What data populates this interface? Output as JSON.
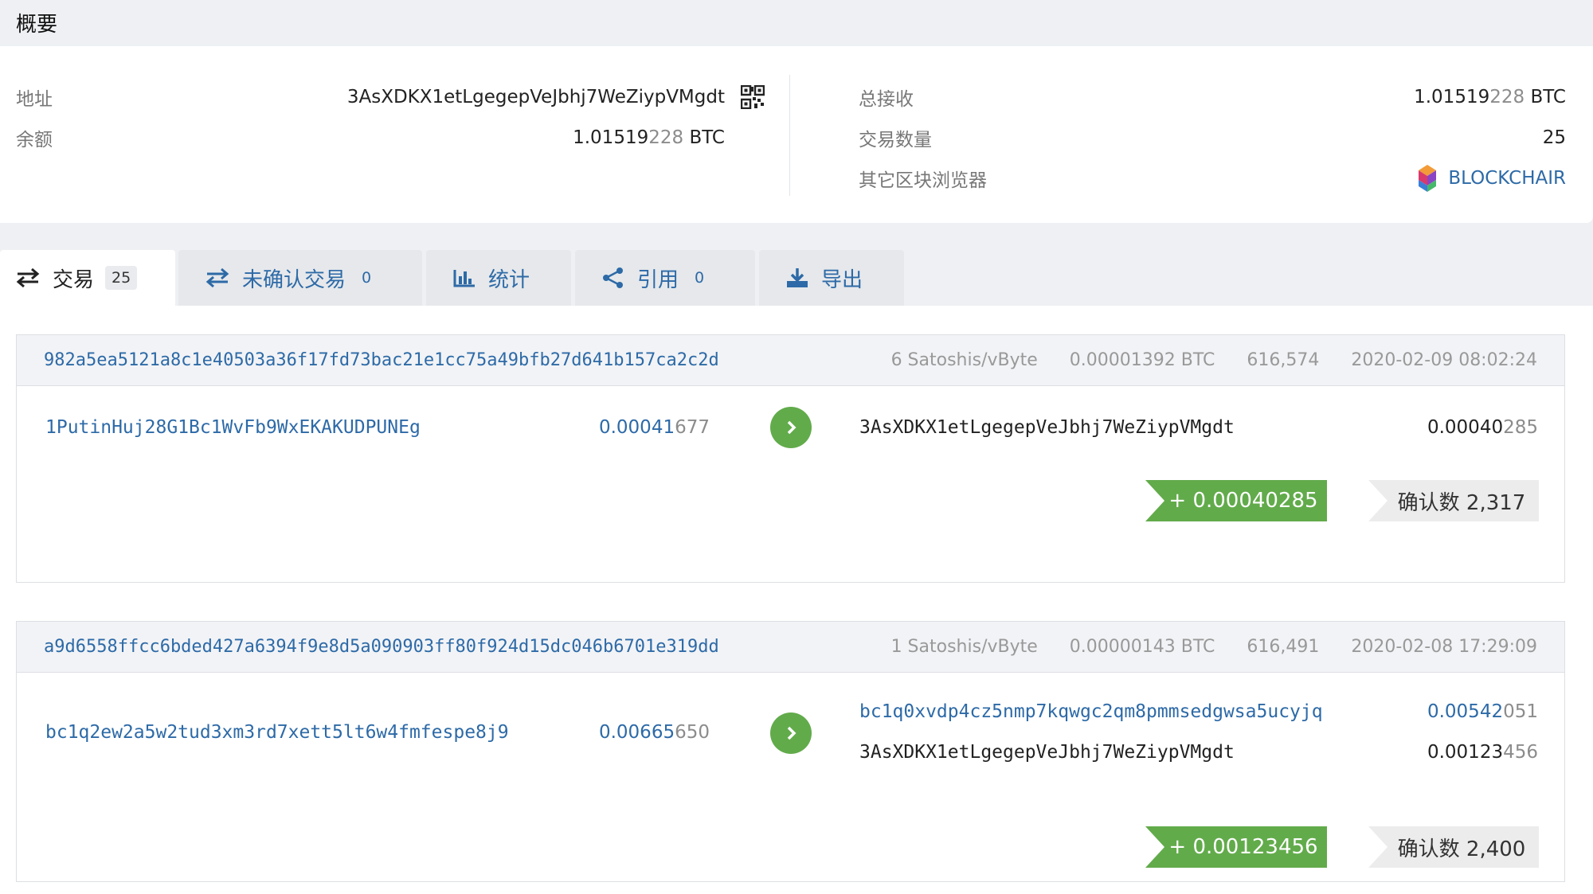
{
  "summary": {
    "title": "概要",
    "address_label": "地址",
    "address_value": "3AsXDKX1etLgegepVeJbhj7WeZiypVMgdt",
    "balance_label": "余额",
    "balance_strong": "1.01519",
    "balance_dim": "228",
    "balance_unit": " BTC",
    "total_received_label": "总接收",
    "total_received_strong": "1.01519",
    "total_received_dim": "228",
    "total_received_unit": " BTC",
    "tx_count_label": "交易数量",
    "tx_count_value": "25",
    "explorers_label": "其它区块浏览器",
    "explorer_name": "BLOCKCHAIR"
  },
  "tabs": [
    {
      "label": "交易",
      "count": "25",
      "icon": "transfer-icon"
    },
    {
      "label": "未确认交易",
      "count": "0",
      "icon": "transfer-icon"
    },
    {
      "label": "统计",
      "count": "",
      "icon": "bar-chart-icon"
    },
    {
      "label": "引用",
      "count": "0",
      "icon": "share-icon"
    },
    {
      "label": "导出",
      "count": "",
      "icon": "download-icon"
    }
  ],
  "transactions": [
    {
      "hash": "982a5ea5121a8c1e40503a36f17fd73bac21e1cc75a49bfb27d641b157ca2c2d",
      "fee_rate": "6 Satoshis/vByte",
      "fee": "0.00001392 BTC",
      "block": "616,574",
      "time": "2020-02-09 08:02:24",
      "input_address": "1PutinHuj28G1Bc1WvFb9WxEKAKUDPUNEg",
      "input_amount_strong": "0.00041",
      "input_amount_dim": "677",
      "outputs": [
        {
          "address": "3AsXDKX1etLgegepVeJbhj7WeZiypVMgdt",
          "amount_strong": "0.00040",
          "amount_dim": "285"
        }
      ],
      "net_change": "+ 0.00040285",
      "confirmations": "确认数 2,317"
    },
    {
      "hash": "a9d6558ffcc6bded427a6394f9e8d5a090903ff80f924d15dc046b6701e319dd",
      "fee_rate": "1 Satoshis/vByte",
      "fee": "0.00000143 BTC",
      "block": "616,491",
      "time": "2020-02-08 17:29:09",
      "input_address": "bc1q2ew2a5w2tud3xm3rd7xett5lt6w4fmfespe8j9",
      "input_amount_strong": "0.00665",
      "input_amount_dim": "650",
      "outputs": [
        {
          "address": "bc1q0xvdp4cz5nmp7kqwgc2qm8pmmsedgwsa5ucyjq",
          "amount_strong": "0.00542",
          "amount_dim": "051"
        },
        {
          "address": "3AsXDKX1etLgegepVeJbhj7WeZiypVMgdt",
          "amount_strong": "0.00123",
          "amount_dim": "456"
        }
      ],
      "net_change": "+ 0.00123456",
      "confirmations": "确认数 2,400"
    }
  ],
  "colors": {
    "link": "#2d6aa7",
    "green": "#62ab4b",
    "background": "#eef0f3"
  }
}
